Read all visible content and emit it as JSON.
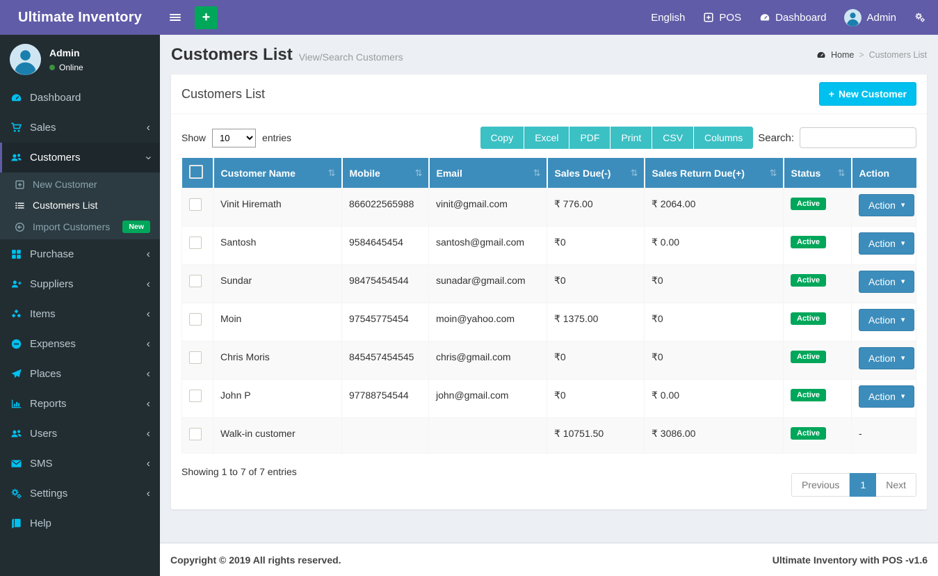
{
  "navbar": {
    "brand": "Ultimate Inventory",
    "english": "English",
    "pos": "POS",
    "dashboard": "Dashboard",
    "user": "Admin"
  },
  "sidebar": {
    "user_name": "Admin",
    "user_status": "Online",
    "items": [
      {
        "label": "Dashboard"
      },
      {
        "label": "Sales"
      },
      {
        "label": "Customers"
      },
      {
        "label": "Purchase"
      },
      {
        "label": "Suppliers"
      },
      {
        "label": "Items"
      },
      {
        "label": "Expenses"
      },
      {
        "label": "Places"
      },
      {
        "label": "Reports"
      },
      {
        "label": "Users"
      },
      {
        "label": "SMS"
      },
      {
        "label": "Settings"
      },
      {
        "label": "Help"
      }
    ],
    "submenu": [
      {
        "label": "New Customer"
      },
      {
        "label": "Customers List"
      },
      {
        "label": "Import Customers",
        "badge": "New"
      }
    ]
  },
  "page": {
    "title": "Customers List",
    "subtitle": "View/Search Customers",
    "breadcrumb_home": "Home",
    "breadcrumb_current": "Customers List"
  },
  "panel": {
    "title": "Customers List",
    "new_customer_label": "New Customer"
  },
  "toolbar": {
    "show_label": "Show",
    "page_length": "10",
    "entries_label": "entries",
    "buttons": [
      "Copy",
      "Excel",
      "PDF",
      "Print",
      "CSV",
      "Columns"
    ],
    "search_label": "Search:"
  },
  "table": {
    "columns": [
      "Customer Name",
      "Mobile",
      "Email",
      "Sales Due(-)",
      "Sales Return Due(+)",
      "Status",
      "Action"
    ],
    "rows": [
      {
        "name": "Vinit Hiremath",
        "mobile": "866022565988",
        "email": "vinit@gmail.com",
        "sales_due": "₹ 776.00",
        "sales_return_due": "₹ 2064.00",
        "status": "Active",
        "action": "Action"
      },
      {
        "name": "Santosh",
        "mobile": "9584645454",
        "email": "santosh@gmail.com",
        "sales_due": "₹0",
        "sales_return_due": "₹ 0.00",
        "status": "Active",
        "action": "Action"
      },
      {
        "name": "Sundar",
        "mobile": "98475454544",
        "email": "sunadar@gmail.com",
        "sales_due": "₹0",
        "sales_return_due": "₹0",
        "status": "Active",
        "action": "Action"
      },
      {
        "name": "Moin",
        "mobile": "97545775454",
        "email": "moin@yahoo.com",
        "sales_due": "₹ 1375.00",
        "sales_return_due": "₹0",
        "status": "Active",
        "action": "Action"
      },
      {
        "name": "Chris Moris",
        "mobile": "845457454545",
        "email": "chris@gmail.com",
        "sales_due": "₹0",
        "sales_return_due": "₹0",
        "status": "Active",
        "action": "Action"
      },
      {
        "name": "John P",
        "mobile": "97788754544",
        "email": "john@gmail.com",
        "sales_due": "₹0",
        "sales_return_due": "₹ 0.00",
        "status": "Active",
        "action": "Action"
      },
      {
        "name": "Walk-in customer",
        "mobile": "",
        "email": "",
        "sales_due": "₹ 10751.50",
        "sales_return_due": "₹ 3086.00",
        "status": "Active",
        "action": "-"
      }
    ],
    "summary": "Showing 1 to 7 of 7 entries"
  },
  "pagination": {
    "previous": "Previous",
    "page": "1",
    "next": "Next"
  },
  "footer": {
    "left": "Copyright © 2019 All rights reserved.",
    "right": "Ultimate Inventory with POS -v1.6"
  },
  "icons": {
    "plus": "+",
    "caret_down": "▾",
    "sort": "⇅",
    "chevron": "‹",
    "breadcrumb_separator": ">"
  },
  "colors": {
    "navbar_purple": "#605ca8",
    "sidebar_dark": "#222d32",
    "accent_cyan": "#00c0ef",
    "table_header_blue": "#3c8dbc",
    "export_teal": "#3bc0c4",
    "success_green": "#00a65a",
    "content_bg": "#ecf0f5"
  }
}
